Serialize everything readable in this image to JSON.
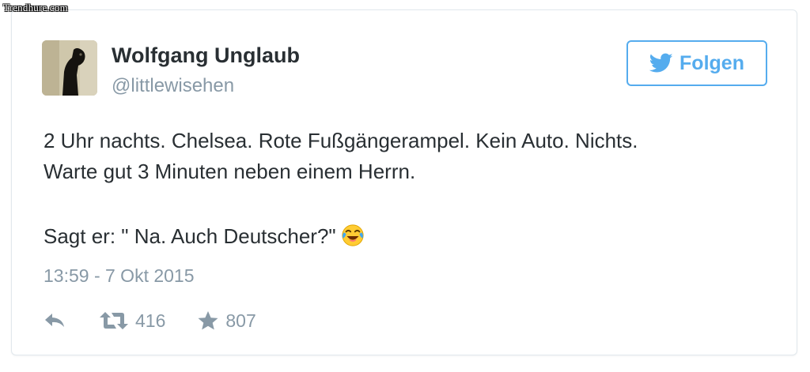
{
  "watermark": "Trendhure.com",
  "tweet": {
    "author": {
      "display_name": "Wolfgang Unglaub",
      "handle": "@littlewisehen"
    },
    "follow_button": {
      "label": "Folgen",
      "icon": "twitter-bird-icon"
    },
    "text_lines": [
      "2 Uhr nachts. Chelsea. Rote Fußgängerampel. Kein Auto. Nichts.",
      "Warte gut 3 Minuten neben einem Herrn.",
      "Sagt er: \" Na. Auch Deutscher?\""
    ],
    "emoji": "face-with-tears-of-joy",
    "timestamp": "13:59 - 7 Okt 2015",
    "actions": {
      "reply_icon": "reply-icon",
      "retweet_icon": "retweet-icon",
      "retweet_count": "416",
      "favorite_icon": "star-icon",
      "favorite_count": "807"
    }
  },
  "colors": {
    "accent": "#55acee",
    "text": "#292f33",
    "muted": "#8899a6",
    "border": "#e1e8ed"
  }
}
